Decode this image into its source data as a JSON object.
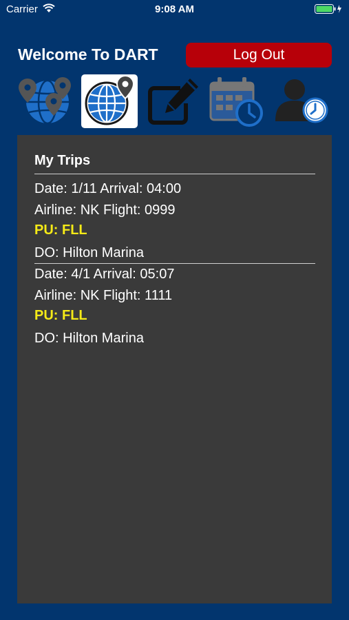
{
  "status_bar": {
    "carrier": "Carrier",
    "time": "9:08 AM"
  },
  "header": {
    "title": "Welcome To DART",
    "logout_label": "Log Out"
  },
  "nav_icons": [
    {
      "name": "map-pins-icon",
      "active": false
    },
    {
      "name": "globe-pin-icon",
      "active": true
    },
    {
      "name": "edit-icon",
      "active": false
    },
    {
      "name": "calendar-clock-icon",
      "active": false
    },
    {
      "name": "user-clock-icon",
      "active": false
    }
  ],
  "colors": {
    "background": "#02356e",
    "panel": "#3a3a3a",
    "logout": "#b70009",
    "pickup": "#f5ea17",
    "icon_blue": "#1f6fc9"
  },
  "trips": {
    "heading": "My Trips",
    "items": [
      {
        "date_line": "Date: 1/11 Arrival: 04:00",
        "flight_line": "Airline: NK Flight: 0999",
        "pickup_line": "PU: FLL",
        "dropoff_line": "DO: Hilton Marina"
      },
      {
        "date_line": "Date: 4/1 Arrival: 05:07",
        "flight_line": "Airline: NK Flight: 1111",
        "pickup_line": "PU: FLL",
        "dropoff_line": "DO: Hilton Marina"
      }
    ]
  }
}
